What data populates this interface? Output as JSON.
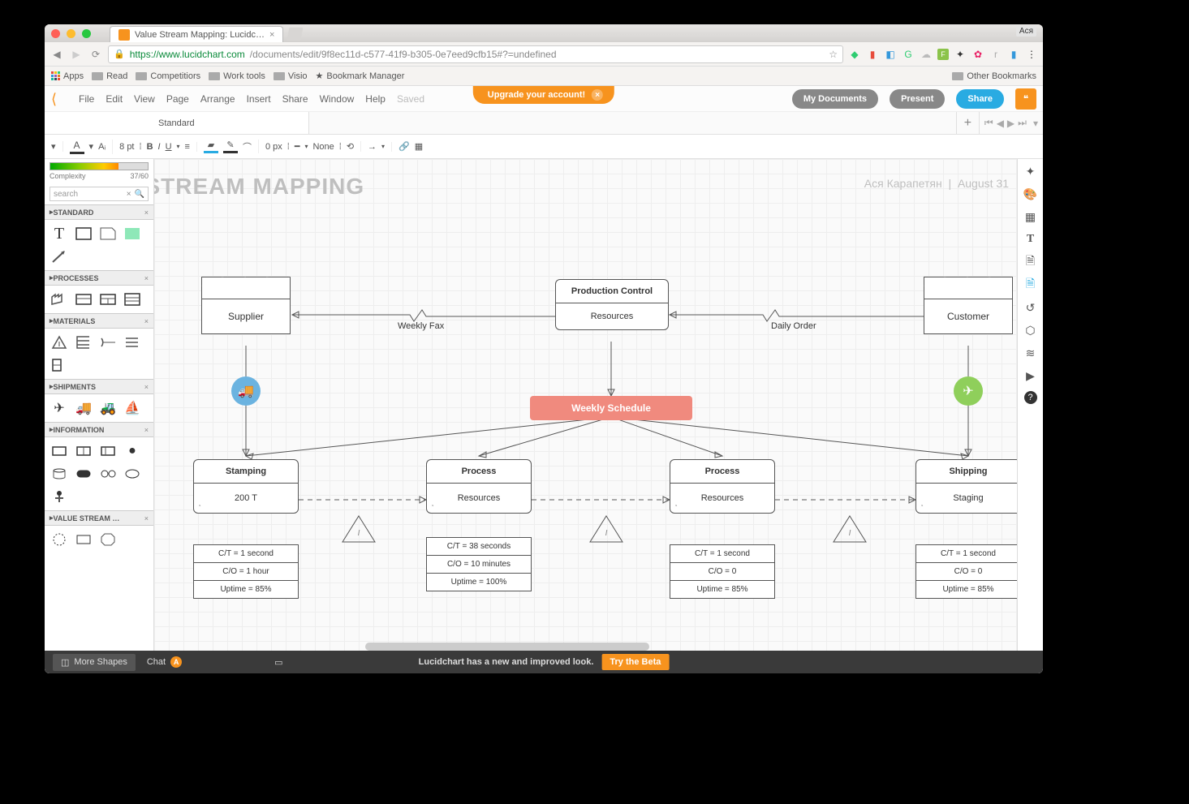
{
  "browser": {
    "tab_title": "Value Stream Mapping: Lucidc…",
    "url_host": "https://www.lucidchart.com",
    "url_rest": "/documents/edit/9f8ec11d-c577-41f9-b305-0e7eed9cfb15#?=undefined",
    "profile": "Ася",
    "bookmarks": {
      "apps": "Apps",
      "read": "Read",
      "comp": "Competitiors",
      "work": "Work tools",
      "visio": "Visio",
      "bmgr": "Bookmark Manager",
      "other": "Other Bookmarks"
    }
  },
  "app": {
    "upgrade": "Upgrade your account!",
    "menu": {
      "file": "File",
      "edit": "Edit",
      "view": "View",
      "page": "Page",
      "arrange": "Arrange",
      "insert": "Insert",
      "share": "Share",
      "window": "Window",
      "help": "Help",
      "saved": "Saved"
    },
    "buttons": {
      "mydocs": "My Documents",
      "present": "Present",
      "share": "Share"
    },
    "page_tab": "Standard",
    "toolbar": {
      "fontsize": "8 pt",
      "border": "0 px",
      "line_style": "None"
    },
    "complexity_label": "Complexity",
    "complexity_val": "37/60",
    "search_placeholder": "search",
    "panels": {
      "standard": "STANDARD",
      "processes": "PROCESSES",
      "materials": "MATERIALS",
      "shipments": "SHIPMENTS",
      "information": "INFORMATION",
      "vsm": "VALUE STREAM …"
    },
    "bottom": {
      "more": "More Shapes",
      "chat": "Chat",
      "chat_badge": "A",
      "beta_msg": "Lucidchart has a new and improved look.",
      "beta_btn": "Try the Beta"
    }
  },
  "doc": {
    "title": "E STREAM MAPPING",
    "author": "Ася Карапетян",
    "date": "August 31",
    "supplier": "Supplier",
    "customer": "Customer",
    "prod_control": {
      "h": "Production Control",
      "b": "Resources"
    },
    "weekly_fax": "Weekly Fax",
    "daily_order": "Daily Order",
    "weekly_schedule": "Weekly Schedule",
    "p1": {
      "h": "Stamping",
      "b": "200 T"
    },
    "p2": {
      "h": "Process",
      "b": "Resources"
    },
    "p3": {
      "h": "Process",
      "b": "Resources"
    },
    "p4": {
      "h": "Shipping",
      "b": "Staging"
    },
    "d1": {
      "a": "C/T = 1 second",
      "b": "C/O = 1 hour",
      "c": "Uptime = 85%"
    },
    "d2": {
      "a": "C/T = 38 seconds",
      "b": "C/O = 10 minutes",
      "c": "Uptime = 100%"
    },
    "d3": {
      "a": "C/T = 1 second",
      "b": "C/O = 0",
      "c": "Uptime = 85%"
    },
    "d4": {
      "a": "C/T = 1 second",
      "b": "C/O = 0",
      "c": "Uptime = 85%"
    }
  }
}
